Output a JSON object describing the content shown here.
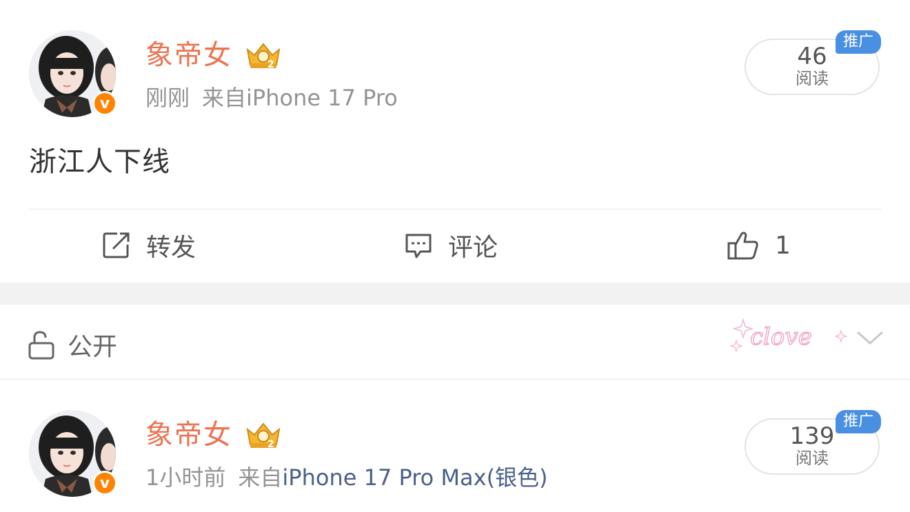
{
  "posts": [
    {
      "username": "象帝女",
      "time": "刚刚",
      "source_prefix": "来自",
      "device": "iPhone 17 Pro",
      "reads_count": "46",
      "reads_label": "阅读",
      "promo_label": "推广",
      "verified_badge": "v",
      "content": "浙江人下线",
      "actions": {
        "repost_label": "转发",
        "comment_label": "评论",
        "like_count": "1"
      }
    },
    {
      "username": "象帝女",
      "time": "1小时前",
      "source_prefix": "来自",
      "device": "iPhone 17 Pro Max(银色)",
      "reads_count": "139",
      "reads_label": "阅读",
      "promo_label": "推广",
      "verified_badge": "v"
    }
  ],
  "privacy": {
    "label": "公开",
    "icon": "unlocked-padlock-icon",
    "decoration_text": "clove",
    "dropdown_icon": "chevron-down-icon"
  },
  "colors": {
    "username": "#eb7350",
    "verified_badge": "#ff8200",
    "promo_badge": "#4a90e2",
    "meta_text": "#939393",
    "section_gap": "#f2f2f2"
  }
}
